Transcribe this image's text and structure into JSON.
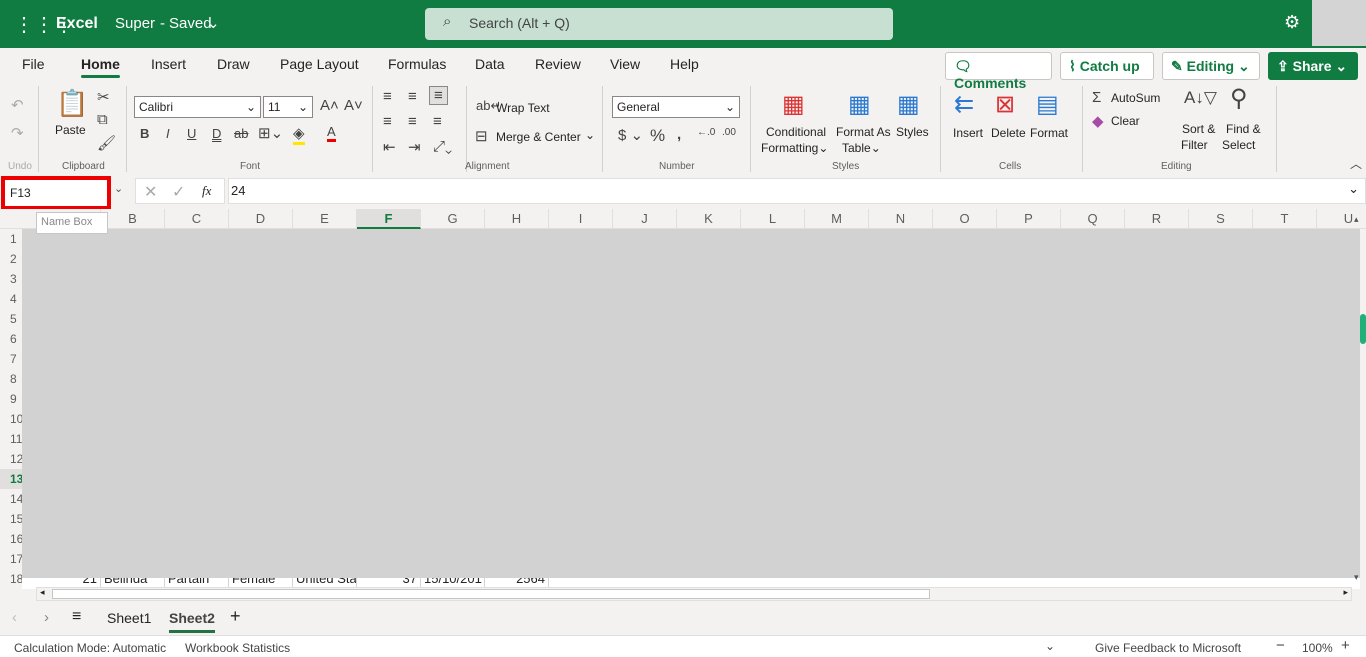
{
  "app": {
    "name": "Excel",
    "doc_title": "Super",
    "saved_status": "Saved",
    "search_placeholder": "Search (Alt + Q)"
  },
  "tabs": [
    "File",
    "Home",
    "Insert",
    "Draw",
    "Page Layout",
    "Formulas",
    "Data",
    "Review",
    "View",
    "Help"
  ],
  "active_tab": "Home",
  "ribbon_buttons": {
    "comments": "Comments",
    "catch_up": "Catch up",
    "editing": "Editing",
    "share": "Share"
  },
  "groups": {
    "undo": "Undo",
    "clipboard": "Clipboard",
    "font": "Font",
    "alignment": "Alignment",
    "number": "Number",
    "styles": "Styles",
    "cells": "Cells",
    "editing": "Editing"
  },
  "clipboard": {
    "paste": "Paste"
  },
  "font": {
    "name": "Calibri",
    "size": "11"
  },
  "alignment": {
    "wrap_text": "Wrap Text",
    "merge_center": "Merge & Center"
  },
  "number": {
    "format": "General"
  },
  "styles": {
    "conditional_1": "Conditional",
    "conditional_2": "Formatting",
    "format_table_1": "Format As",
    "format_table_2": "Table",
    "styles": "Styles"
  },
  "cells": {
    "insert": "Insert",
    "delete": "Delete",
    "format": "Format"
  },
  "editing": {
    "autosum": "AutoSum",
    "clear": "Clear",
    "sort_1": "Sort &",
    "sort_2": "Filter",
    "find_1": "Find &",
    "find_2": "Select"
  },
  "formula_bar": {
    "name_box": "F13",
    "value": "24",
    "fx": "fx",
    "tooltip": "Name Box"
  },
  "columns": [
    "A",
    "B",
    "C",
    "D",
    "E",
    "F",
    "G",
    "H",
    "I",
    "J",
    "K",
    "L",
    "M",
    "N",
    "O",
    "P",
    "Q",
    "R",
    "S",
    "T",
    "U"
  ],
  "selected_column": "F",
  "rows": [
    "1",
    "2",
    "3",
    "4",
    "5",
    "6",
    "7",
    "8",
    "9",
    "10",
    "11",
    "12",
    "13",
    "14",
    "15",
    "16",
    "17",
    "18"
  ],
  "selected_row": "13",
  "row18": [
    "21",
    "Belinda",
    "Partain",
    "Female",
    "United Sta",
    "37",
    "15/10/201",
    "2564"
  ],
  "sheets": [
    "Sheet1",
    "Sheet2"
  ],
  "active_sheet": "Sheet2",
  "status": {
    "calc_mode": "Calculation Mode: Automatic",
    "stats": "Workbook Statistics",
    "feedback": "Give Feedback to Microsoft",
    "zoom": "100%"
  },
  "colors": {
    "brand": "#107c41",
    "highlight": "#e00000"
  }
}
